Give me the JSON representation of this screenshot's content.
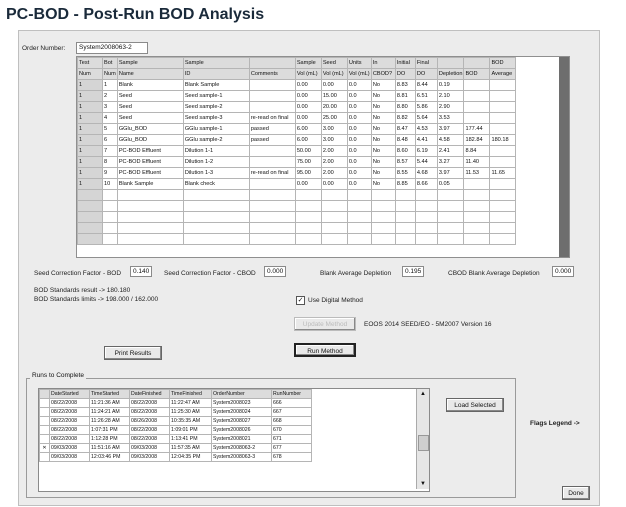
{
  "app": {
    "title": "PC-BOD - Post-Run BOD Analysis"
  },
  "order": {
    "label": "Order Number:",
    "value": "System2008063-2"
  },
  "grid": {
    "header1": [
      "Test",
      "Bot",
      "Sample",
      "Sample",
      "",
      "Sample",
      "Seed",
      "Units",
      "In",
      "Initial",
      "Final",
      "",
      "",
      "BOD"
    ],
    "header2": [
      "Num",
      "Num",
      "Name",
      "ID",
      "Comments",
      "Vol (mL)",
      "Vol (mL)",
      "Vol (mL)",
      "CBOD?",
      "DO",
      "DO",
      "Depletion",
      "BOD",
      "Average"
    ],
    "rows": [
      [
        "1",
        "1",
        "Blank",
        "Blank Sample",
        "",
        "0.00",
        "0.00",
        "0.0",
        "No",
        "8.83",
        "8.44",
        "0.19",
        "",
        ""
      ],
      [
        "1",
        "2",
        "Seed",
        "Seed sample-1",
        "",
        "0.00",
        "15.00",
        "0.0",
        "No",
        "8.81",
        "6.51",
        "2.10",
        "",
        ""
      ],
      [
        "1",
        "3",
        "Seed",
        "Seed sample-2",
        "",
        "0.00",
        "20.00",
        "0.0",
        "No",
        "8.80",
        "5.86",
        "2.90",
        "",
        ""
      ],
      [
        "1",
        "4",
        "Seed",
        "Seed sample-3",
        "re-read on final",
        "0.00",
        "25.00",
        "0.0",
        "No",
        "8.82",
        "5.64",
        "3.53",
        "",
        ""
      ],
      [
        "1",
        "5",
        "GGlu_BOD",
        "GGlu sample-1",
        "passed",
        "6.00",
        "3.00",
        "0.0",
        "No",
        "8.47",
        "4.53",
        "3.97",
        "177.44",
        ""
      ],
      [
        "1",
        "6",
        "GGlu_BOD",
        "GGlu sample-2",
        "passed",
        "6.00",
        "3.00",
        "0.0",
        "No",
        "8.48",
        "4.41",
        "4.58",
        "182.84",
        "180.18"
      ],
      [
        "1",
        "7",
        "PC-BOD Effluent",
        "Dilution 1-1",
        "",
        "50.00",
        "2.00",
        "0.0",
        "No",
        "8.60",
        "6.19",
        "2.41",
        "8.84",
        ""
      ],
      [
        "1",
        "8",
        "PC-BOD Effluent",
        "Dilution 1-2",
        "",
        "75.00",
        "2.00",
        "0.0",
        "No",
        "8.57",
        "5.44",
        "3.27",
        "11.40",
        ""
      ],
      [
        "1",
        "9",
        "PC-BOD Effluent",
        "Dilution 1-3",
        "re-read on final",
        "95.00",
        "2.00",
        "0.0",
        "No",
        "8.55",
        "4.68",
        "3.97",
        "11.53",
        "11.65"
      ],
      [
        "1",
        "10",
        "Blank Sample",
        "Blank check",
        "",
        "0.00",
        "0.00",
        "0.0",
        "No",
        "8.85",
        "8.66",
        "0.05",
        "",
        ""
      ]
    ]
  },
  "factors": {
    "seed_bod_label": "Seed Correction Factor - BOD",
    "seed_bod_value": "0.140",
    "seed_cbod_label": "Seed Correction Factor - CBOD",
    "seed_cbod_value": "0.000",
    "blank_label": "Blank Average Depletion",
    "blank_value": "0.195",
    "cbod_blank_label": "CBOD Blank Average Depletion",
    "cbod_blank_value": "0.000"
  },
  "standards": {
    "line1": "BOD Standards result -> 180.180",
    "line2": "BOD Standards limits -> 198.000 / 162.000"
  },
  "options": {
    "digital_method_label": "Use Digital Method",
    "digital_method_checked": "✓"
  },
  "buttons": {
    "update_method": "Update Method",
    "run_method": "Run Method",
    "print_results": "Print Results",
    "load_selected": "Load Selected",
    "done": "Done"
  },
  "method_info": "EOOS 2014 SEED/EO - 5M2007 Version 16",
  "runs": {
    "group_title": "Runs to Complete",
    "headers": [
      "DateStarted",
      "TimeStarted",
      "DateFinished",
      "TimeFinished",
      "OrderNumber",
      "RunNumber"
    ],
    "rows": [
      [
        "08/22/2008",
        "11:21:36 AM",
        "08/22/2008",
        "11:22:47 AM",
        "System2008023",
        "666",
        ""
      ],
      [
        "08/22/2008",
        "11:24:21 AM",
        "08/22/2008",
        "11:25:30 AM",
        "System2008024",
        "667",
        ""
      ],
      [
        "08/22/2008",
        "11:26:28 AM",
        "08/26/2008",
        "10:35:35 AM",
        "System2008027",
        "668",
        ""
      ],
      [
        "08/22/2008",
        "1:07:31 PM",
        "08/22/2008",
        "1:09:01 PM",
        "System2008026",
        "670",
        ""
      ],
      [
        "08/22/2008",
        "1:12:28 PM",
        "08/22/2008",
        "1:13:41 PM",
        "System2008021",
        "671",
        ""
      ],
      [
        "09/03/2008",
        "11:51:16 AM",
        "09/03/2008",
        "11:57:35 AM",
        "System2008063-2",
        "677",
        "✕"
      ],
      [
        "09/03/2008",
        "12:03:46 PM",
        "09/03/2008",
        "12:04:35 PM",
        "System2008063-3",
        "678",
        ""
      ]
    ]
  },
  "flags_legend": "Flags Legend ->"
}
